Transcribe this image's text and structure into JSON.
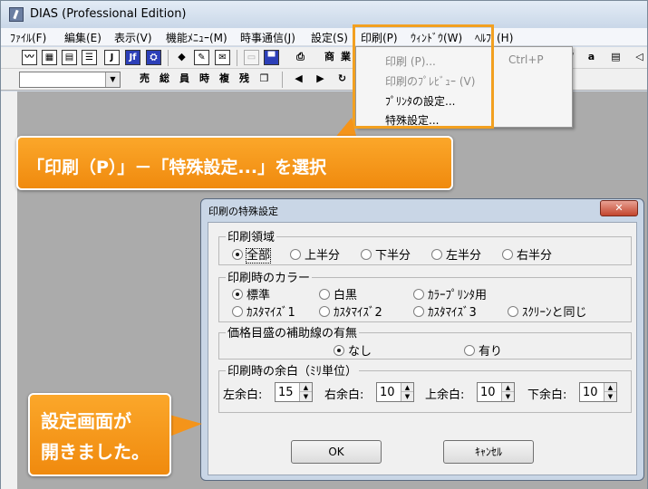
{
  "window": {
    "title": "DIAS (Professional Edition)"
  },
  "menubar": {
    "items": [
      "ﾌｧｲﾙ(F)",
      "編集(E)",
      "表示(V)",
      "機能ﾒﾆｭｰ(M)",
      "時事通信(J)",
      "設定(S)",
      "印刷(P)",
      "ｳｨﾝﾄﾞｳ(W)",
      "ﾍﾙﾌﾟ(H)"
    ]
  },
  "toolbar": {
    "combo_value": "",
    "text_buttons": [
      "J",
      "Jf",
      "商",
      "業",
      "売",
      "総",
      "員",
      "時",
      "複",
      "残",
      "a"
    ]
  },
  "print_menu": {
    "items": [
      {
        "label": "印刷 (P)...",
        "enabled": false,
        "shortcut": "Ctrl+P"
      },
      {
        "label": "印刷のﾌﾟﾚﾋﾞｭｰ (V)",
        "enabled": false
      },
      {
        "label": "ﾌﾟﾘﾝﾀの設定...",
        "enabled": true
      },
      {
        "label": "特殊設定...",
        "enabled": true
      }
    ]
  },
  "callouts": {
    "instruction": "「印刷（P）」－「特殊設定...」を選択",
    "result_line1": "設定画面が",
    "result_line2": "開きました。"
  },
  "dialog": {
    "title": "印刷の特殊設定",
    "close_symbol": "✕",
    "print_area": {
      "label": "印刷領域",
      "options": [
        "全部",
        "上半分",
        "下半分",
        "左半分",
        "右半分"
      ],
      "selected": "全部"
    },
    "print_color": {
      "label": "印刷時のカラー",
      "options": [
        "標準",
        "白黒",
        "ｶﾗｰﾌﾟﾘﾝﾀ用",
        "ｶｽﾀﾏｲｽﾞ1",
        "ｶｽﾀﾏｲｽﾞ2",
        "ｶｽﾀﾏｲｽﾞ3",
        "ｽｸﾘｰﾝと同じ"
      ],
      "selected": "標準"
    },
    "gridlines": {
      "label": "価格目盛の補助線の有無",
      "options": [
        "なし",
        "有り"
      ],
      "selected": "なし"
    },
    "margins": {
      "label": "印刷時の余白（ﾐﾘ単位）",
      "fields": [
        {
          "label": "左余白:",
          "value": "15"
        },
        {
          "label": "右余白:",
          "value": "10"
        },
        {
          "label": "上余白:",
          "value": "10"
        },
        {
          "label": "下余白:",
          "value": "10"
        }
      ]
    },
    "ok_label": "OK",
    "cancel_label": "ｷｬﾝｾﾙ"
  },
  "colors": {
    "accent_orange": "#f2a020",
    "workspace_gray": "#ababab",
    "close_red": "#c3452d"
  }
}
